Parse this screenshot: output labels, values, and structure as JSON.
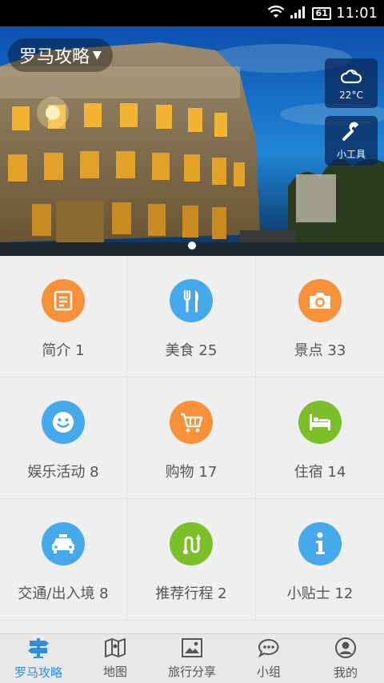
{
  "status_bar": {
    "time": "11:01",
    "battery": "61"
  },
  "hero": {
    "city_label": "罗马攻略",
    "weather": {
      "temperature": "22°C"
    },
    "tools_label": "小工具"
  },
  "grid": [
    {
      "label": "简介 1",
      "color": "#f7913a",
      "icon": "document-icon"
    },
    {
      "label": "美食 25",
      "color": "#46a9ec",
      "icon": "fork-knife-icon"
    },
    {
      "label": "景点 33",
      "color": "#f7913a",
      "icon": "camera-icon"
    },
    {
      "label": "娱乐活动 8",
      "color": "#46a9ec",
      "icon": "smiley-icon"
    },
    {
      "label": "购物 17",
      "color": "#f7913a",
      "icon": "cart-icon"
    },
    {
      "label": "住宿 14",
      "color": "#7dbf2b",
      "icon": "bed-icon"
    },
    {
      "label": "交通/出入境 8",
      "color": "#46a9ec",
      "icon": "taxi-icon"
    },
    {
      "label": "推荐行程 2",
      "color": "#7dbf2b",
      "icon": "route-icon"
    },
    {
      "label": "小贴士 12",
      "color": "#46a9ec",
      "icon": "info-icon"
    }
  ],
  "bottom_nav": [
    {
      "label": "罗马攻略",
      "icon": "signpost-icon",
      "active": true
    },
    {
      "label": "地图",
      "icon": "map-icon",
      "active": false
    },
    {
      "label": "旅行分享",
      "icon": "picture-icon",
      "active": false
    },
    {
      "label": "小组",
      "icon": "chat-icon",
      "active": false
    },
    {
      "label": "我的",
      "icon": "user-icon",
      "active": false
    }
  ],
  "colors": {
    "accent": "#2f8fdb",
    "orange": "#f7913a",
    "blue": "#46a9ec",
    "green": "#7dbf2b"
  }
}
